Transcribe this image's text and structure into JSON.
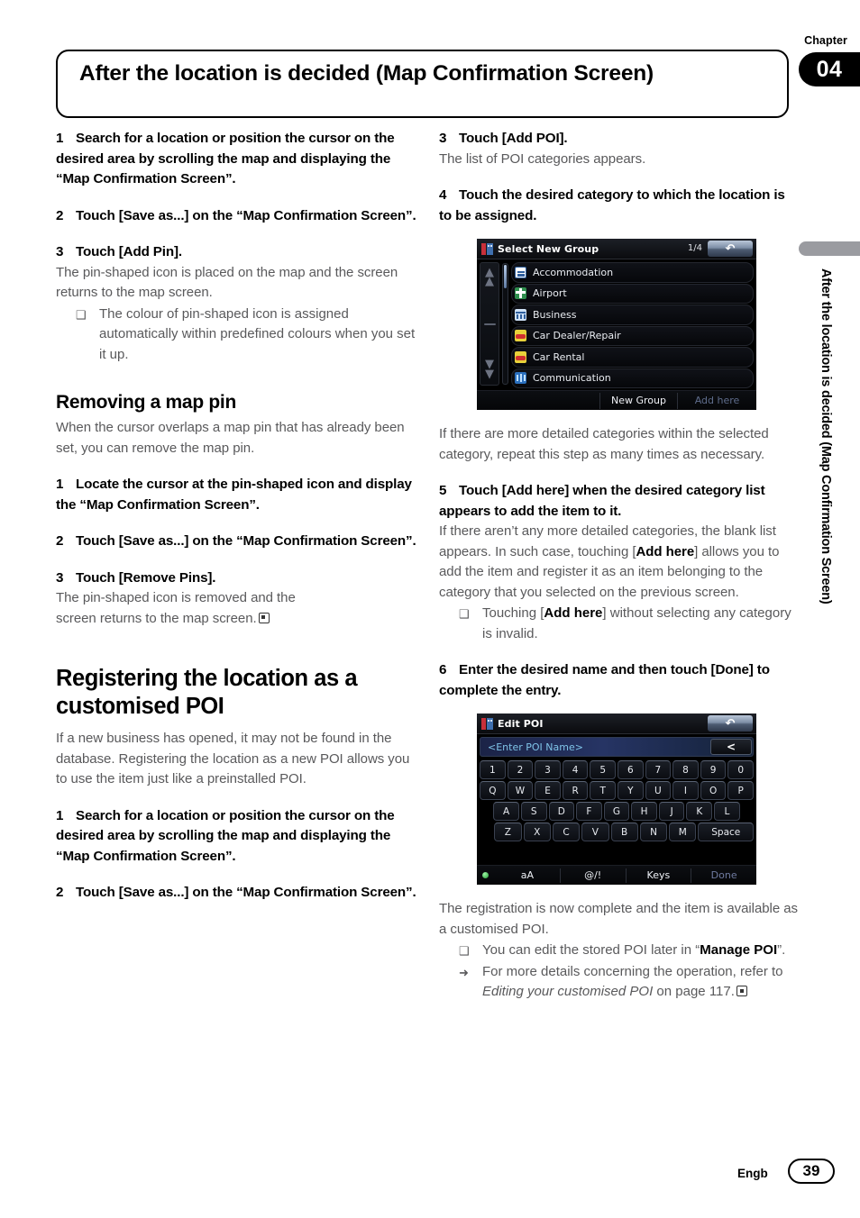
{
  "chapter": {
    "label": "Chapter",
    "number": "04"
  },
  "title": "After the location is decided (Map Confirmation Screen)",
  "side_tab": "After the location is decided (Map Confirmation Screen)",
  "footer": {
    "language": "Engb",
    "page": "39"
  },
  "left_column": {
    "step1": {
      "num": "1",
      "text": "Search for a location or position the cursor on the desired area by scrolling the map and displaying the “Map Confirmation Screen”."
    },
    "step2": {
      "num": "2",
      "text": "Touch [Save as...] on the “Map Confirmation Screen”."
    },
    "step3": {
      "num": "3",
      "text": "Touch [Add Pin]."
    },
    "step3_body": "The pin-shaped icon is placed on the map and the screen returns to the map screen.",
    "step3_note": "The colour of pin-shaped icon is assigned automatically within predefined colours when you set it up.",
    "section_removing": {
      "heading": "Removing a map pin",
      "intro": "When the cursor overlaps a map pin that has already been set, you can remove the map pin.",
      "step1": {
        "num": "1",
        "text": "Locate the cursor at the pin-shaped icon and display the “Map Confirmation Screen”."
      },
      "step2": {
        "num": "2",
        "text": "Touch [Save as...] on the “Map Confirmation Screen”."
      },
      "step3": {
        "num": "3",
        "text": "Touch [Remove Pins]."
      },
      "step3_body_a": "The pin-shaped icon is removed and the",
      "step3_body_b": "screen returns to the map screen."
    },
    "section_registering": {
      "heading": "Registering the location as a customised POI",
      "intro": "If a new business has opened, it may not be found in the database. Registering the location as a new POI allows you to use the item just like a  preinstalled POI.",
      "step1": {
        "num": "1",
        "text": "Search for a location or position the cursor on the desired area by scrolling the map and displaying the “Map Confirmation Screen”."
      },
      "step2": {
        "num": "2",
        "text": "Touch [Save as...] on the “Map Confirmation Screen”."
      }
    }
  },
  "right_column": {
    "step3": {
      "num": "3",
      "text": "Touch [Add POI]."
    },
    "step3_body": "The list of POI categories appears.",
    "step4": {
      "num": "4",
      "text": "Touch the desired category to which the location is to be assigned."
    },
    "after_list_body": "If there are more detailed categories within the selected category, repeat this step as many times as necessary.",
    "step5": {
      "num": "5",
      "text": "Touch [Add here] when the desired category list appears to add the item to it."
    },
    "step5_body_1": "If there aren’t any more detailed categories, the blank list appears. In such case, touching [",
    "step5_body_bold": "Add here",
    "step5_body_2": "] allows you to add the item and register it as an item belonging to the category that you selected on the previous screen.",
    "step5_note_1": "Touching [",
    "step5_note_bold": "Add here",
    "step5_note_2": "] without selecting any category is invalid.",
    "step6": {
      "num": "6",
      "text": "Enter the desired name and then touch [Done] to complete the entry."
    },
    "after_kb_body": "The registration is now complete and the item is available as a customised POI.",
    "note_manage_1": "You can edit the stored POI later in “",
    "note_manage_bold": "Manage POI",
    "note_manage_2": "”.",
    "note_refer_1": "For more details concerning the operation, refer to ",
    "note_refer_italic": "Editing your customised POI",
    "note_refer_2": " on page 117."
  },
  "device_list": {
    "icon_name": "poi-group-icon",
    "title": "Select New Group",
    "page_indicator": "1/4",
    "back_glyph": "↶",
    "scroll_up_glyph": "⌃",
    "scroll_down_glyph": "⌄",
    "rows": [
      {
        "label": "Accommodation",
        "icon": "bed-icon",
        "color": "#ffffff",
        "accent": "#3060a8"
      },
      {
        "label": "Airport",
        "icon": "airport-icon",
        "color": "#2f8f4e",
        "accent": "#ffffff"
      },
      {
        "label": "Business",
        "icon": "business-icon",
        "color": "#cfe2f7",
        "accent": "#3060a8"
      },
      {
        "label": "Car Dealer/Repair",
        "icon": "car-dealer-icon",
        "color": "#e8d23a",
        "accent": "#d03030"
      },
      {
        "label": "Car Rental",
        "icon": "car-rental-icon",
        "color": "#e8d23a",
        "accent": "#d03030"
      },
      {
        "label": "Communication",
        "icon": "communication-icon",
        "color": "#2a6fbd",
        "accent": "#9fd2ff"
      }
    ],
    "footer": {
      "new_group": "New Group",
      "add_here": "Add here"
    }
  },
  "device_keyboard": {
    "icon_name": "poi-group-icon",
    "title": "Edit POI",
    "back_glyph": "↶",
    "input_placeholder": "<Enter POI Name>",
    "backspace_glyph": "<",
    "rows": [
      [
        "1",
        "2",
        "3",
        "4",
        "5",
        "6",
        "7",
        "8",
        "9",
        "0"
      ],
      [
        "Q",
        "W",
        "E",
        "R",
        "T",
        "Y",
        "U",
        "I",
        "O",
        "P"
      ],
      [
        "A",
        "S",
        "D",
        "F",
        "G",
        "H",
        "J",
        "K",
        "L"
      ],
      [
        "Z",
        "X",
        "C",
        "V",
        "B",
        "N",
        "M"
      ]
    ],
    "space_label": "Space",
    "footer": {
      "case": "aA",
      "symbols": "@/!",
      "keys": "Keys",
      "done": "Done"
    }
  }
}
